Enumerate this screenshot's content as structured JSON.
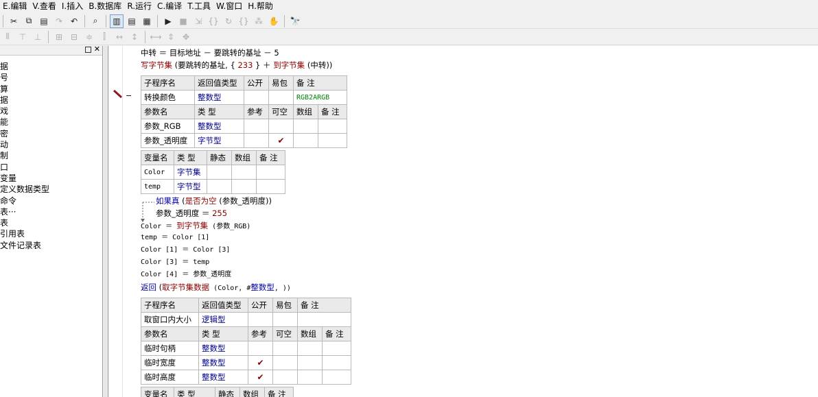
{
  "menu": [
    {
      "key": "E",
      "label": "E.编辑"
    },
    {
      "key": "V",
      "label": "V.查看"
    },
    {
      "key": "I",
      "label": "I.插入"
    },
    {
      "key": "B",
      "label": "B.数据库"
    },
    {
      "key": "R",
      "label": "R.运行"
    },
    {
      "key": "C",
      "label": "C.编译"
    },
    {
      "key": "T",
      "label": "T.工具"
    },
    {
      "key": "W",
      "label": "W.窗口"
    },
    {
      "key": "H",
      "label": "H.帮助"
    }
  ],
  "tree_items": [
    "据",
    "号",
    "算",
    "据",
    "戏",
    "能",
    "密",
    "动",
    "制",
    "口",
    "变量",
    "定义数据类型",
    "命令",
    "表···",
    "表",
    "引用表",
    "文件记录表"
  ],
  "code": {
    "line1": "中转 ＝ 目标地址 － 要跳转的基址 － 5",
    "line2_fn": "写字节集",
    "line2_a": " (要跳转的基址, { ",
    "line2_num": "233",
    "line2_b": " } ＋ ",
    "line2_fn2": "到字节集",
    "line2_c": " (中转))",
    "if_kw": "如果真",
    "if_args": " (",
    "if_fn": "是否为空",
    "if_rest": " (参数_透明度))",
    "if_body": "参数_透明度 ＝ ",
    "if_body_num": "255",
    "l_color": "Color ＝ ",
    "l_color_fn": "到字节集",
    "l_color_rest": " (参数_RGB)",
    "l_temp": "temp ＝ Color [1]",
    "l_c1": "Color [1] ＝ Color [3]",
    "l_c3": "Color [3] ＝ temp",
    "l_c4": "Color [4] ＝ 参数_透明度",
    "ret_kw": "返回",
    "ret_a": " (",
    "ret_fn": "取字节集数据",
    "ret_b": " (Color, #",
    "ret_type": "整数型",
    "ret_c": ", ))"
  },
  "sub1": {
    "headers": [
      "子程序名",
      "返回值类型",
      "公开",
      "易包",
      "备 注"
    ],
    "name": "转换颜色",
    "ret_type": "整数型",
    "note": "RGB2ARGB",
    "param_headers": [
      "参数名",
      "类 型",
      "参考",
      "可空",
      "数组",
      "备 注"
    ],
    "params": [
      {
        "name": "参数_RGB",
        "type": "整数型",
        "ref": "",
        "nullable": ""
      },
      {
        "name": "参数_透明度",
        "type": "字节型",
        "ref": "",
        "nullable": "✔"
      }
    ]
  },
  "vars1": {
    "headers": [
      "变量名",
      "类 型",
      "静态",
      "数组",
      "备 注"
    ],
    "rows": [
      {
        "name": "Color",
        "type": "字节集"
      },
      {
        "name": "temp",
        "type": "字节型"
      }
    ]
  },
  "sub2": {
    "headers": [
      "子程序名",
      "返回值类型",
      "公开",
      "易包",
      "备 注"
    ],
    "name": "取窗口内大小",
    "ret_type": "逻辑型",
    "param_headers": [
      "参数名",
      "类 型",
      "参考",
      "可空",
      "数组",
      "备 注"
    ],
    "params": [
      {
        "name": "临时句柄",
        "type": "整数型",
        "ref": ""
      },
      {
        "name": "临时宽度",
        "type": "整数型",
        "ref": "✔"
      },
      {
        "name": "临时高度",
        "type": "整数型",
        "ref": "✔"
      }
    ]
  },
  "vars2": {
    "headers": [
      "变量名",
      "类 型",
      "静态",
      "数组",
      "备 注"
    ]
  }
}
